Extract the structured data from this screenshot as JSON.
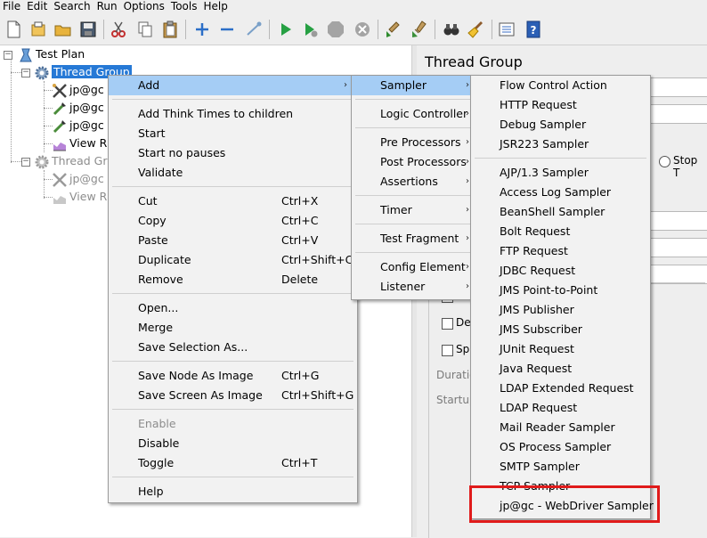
{
  "menubar": [
    "File",
    "Edit",
    "Search",
    "Run",
    "Options",
    "Tools",
    "Help"
  ],
  "toolbar_icons": [
    "new-icon",
    "templates-icon",
    "open-icon",
    "save-icon",
    "cut-icon",
    "copy-icon",
    "paste-icon",
    "expand-icon",
    "collapse-icon",
    "toggle-icon",
    "start-icon",
    "start-no-pause-icon",
    "stop-icon",
    "shutdown-icon",
    "clear-icon",
    "clear-all-icon",
    "search-icon",
    "broom-icon",
    "function-helper-icon",
    "help-icon"
  ],
  "tree": {
    "test_plan": "Test Plan",
    "thread_group_1": "Thread Group",
    "jpgc_1": "jp@gc",
    "jpgc_2": "jp@gc",
    "jpgc_3": "jp@gc",
    "view_1": "View R",
    "thread_group_2": "Thread Gro",
    "jpgc_4": "jp@gc",
    "view_2": "View R"
  },
  "right_panel": {
    "title": "Thread Group",
    "stop_label": "Stop T",
    "chk1": "Sa",
    "chk2": "De",
    "chk3": "Sp",
    "duration": "Duratio",
    "startup": "Startup"
  },
  "context_menu": {
    "items": [
      {
        "label": "Add",
        "arrow": true,
        "highlight": true
      },
      {
        "label": "Add Think Times to children"
      },
      {
        "label": "Start"
      },
      {
        "label": "Start no pauses"
      },
      {
        "label": "Validate"
      },
      {
        "label": "Cut",
        "shortcut": "Ctrl+X"
      },
      {
        "label": "Copy",
        "shortcut": "Ctrl+C"
      },
      {
        "label": "Paste",
        "shortcut": "Ctrl+V"
      },
      {
        "label": "Duplicate",
        "shortcut": "Ctrl+Shift+C"
      },
      {
        "label": "Remove",
        "shortcut": "Delete"
      },
      {
        "label": "Open..."
      },
      {
        "label": "Merge"
      },
      {
        "label": "Save Selection As..."
      },
      {
        "label": "Save Node As Image",
        "shortcut": "Ctrl+G"
      },
      {
        "label": "Save Screen As Image",
        "shortcut": "Ctrl+Shift+G"
      },
      {
        "label": "Enable",
        "disabled": true
      },
      {
        "label": "Disable"
      },
      {
        "label": "Toggle",
        "shortcut": "Ctrl+T"
      },
      {
        "label": "Help"
      }
    ]
  },
  "add_menu": {
    "items": [
      {
        "label": "Sampler",
        "highlight": true
      },
      {
        "label": "Logic Controller"
      },
      {
        "label": "Pre Processors"
      },
      {
        "label": "Post Processors"
      },
      {
        "label": "Assertions"
      },
      {
        "label": "Timer"
      },
      {
        "label": "Test Fragment"
      },
      {
        "label": "Config Element"
      },
      {
        "label": "Listener"
      }
    ]
  },
  "sampler_menu": {
    "items": [
      "Flow Control Action",
      "HTTP Request",
      "Debug Sampler",
      "JSR223 Sampler",
      "AJP/1.3 Sampler",
      "Access Log Sampler",
      "BeanShell Sampler",
      "Bolt Request",
      "FTP Request",
      "JDBC Request",
      "JMS Point-to-Point",
      "JMS Publisher",
      "JMS Subscriber",
      "JUnit Request",
      "Java Request",
      "LDAP Extended Request",
      "LDAP Request",
      "Mail Reader Sampler",
      "OS Process Sampler",
      "SMTP Sampler",
      "TCP Sampler",
      "jp@gc - WebDriver Sampler"
    ]
  },
  "colors": {
    "selection": "#2679d6",
    "menu_highlight": "#a5cdf5",
    "red_box": "#e01b1b"
  }
}
